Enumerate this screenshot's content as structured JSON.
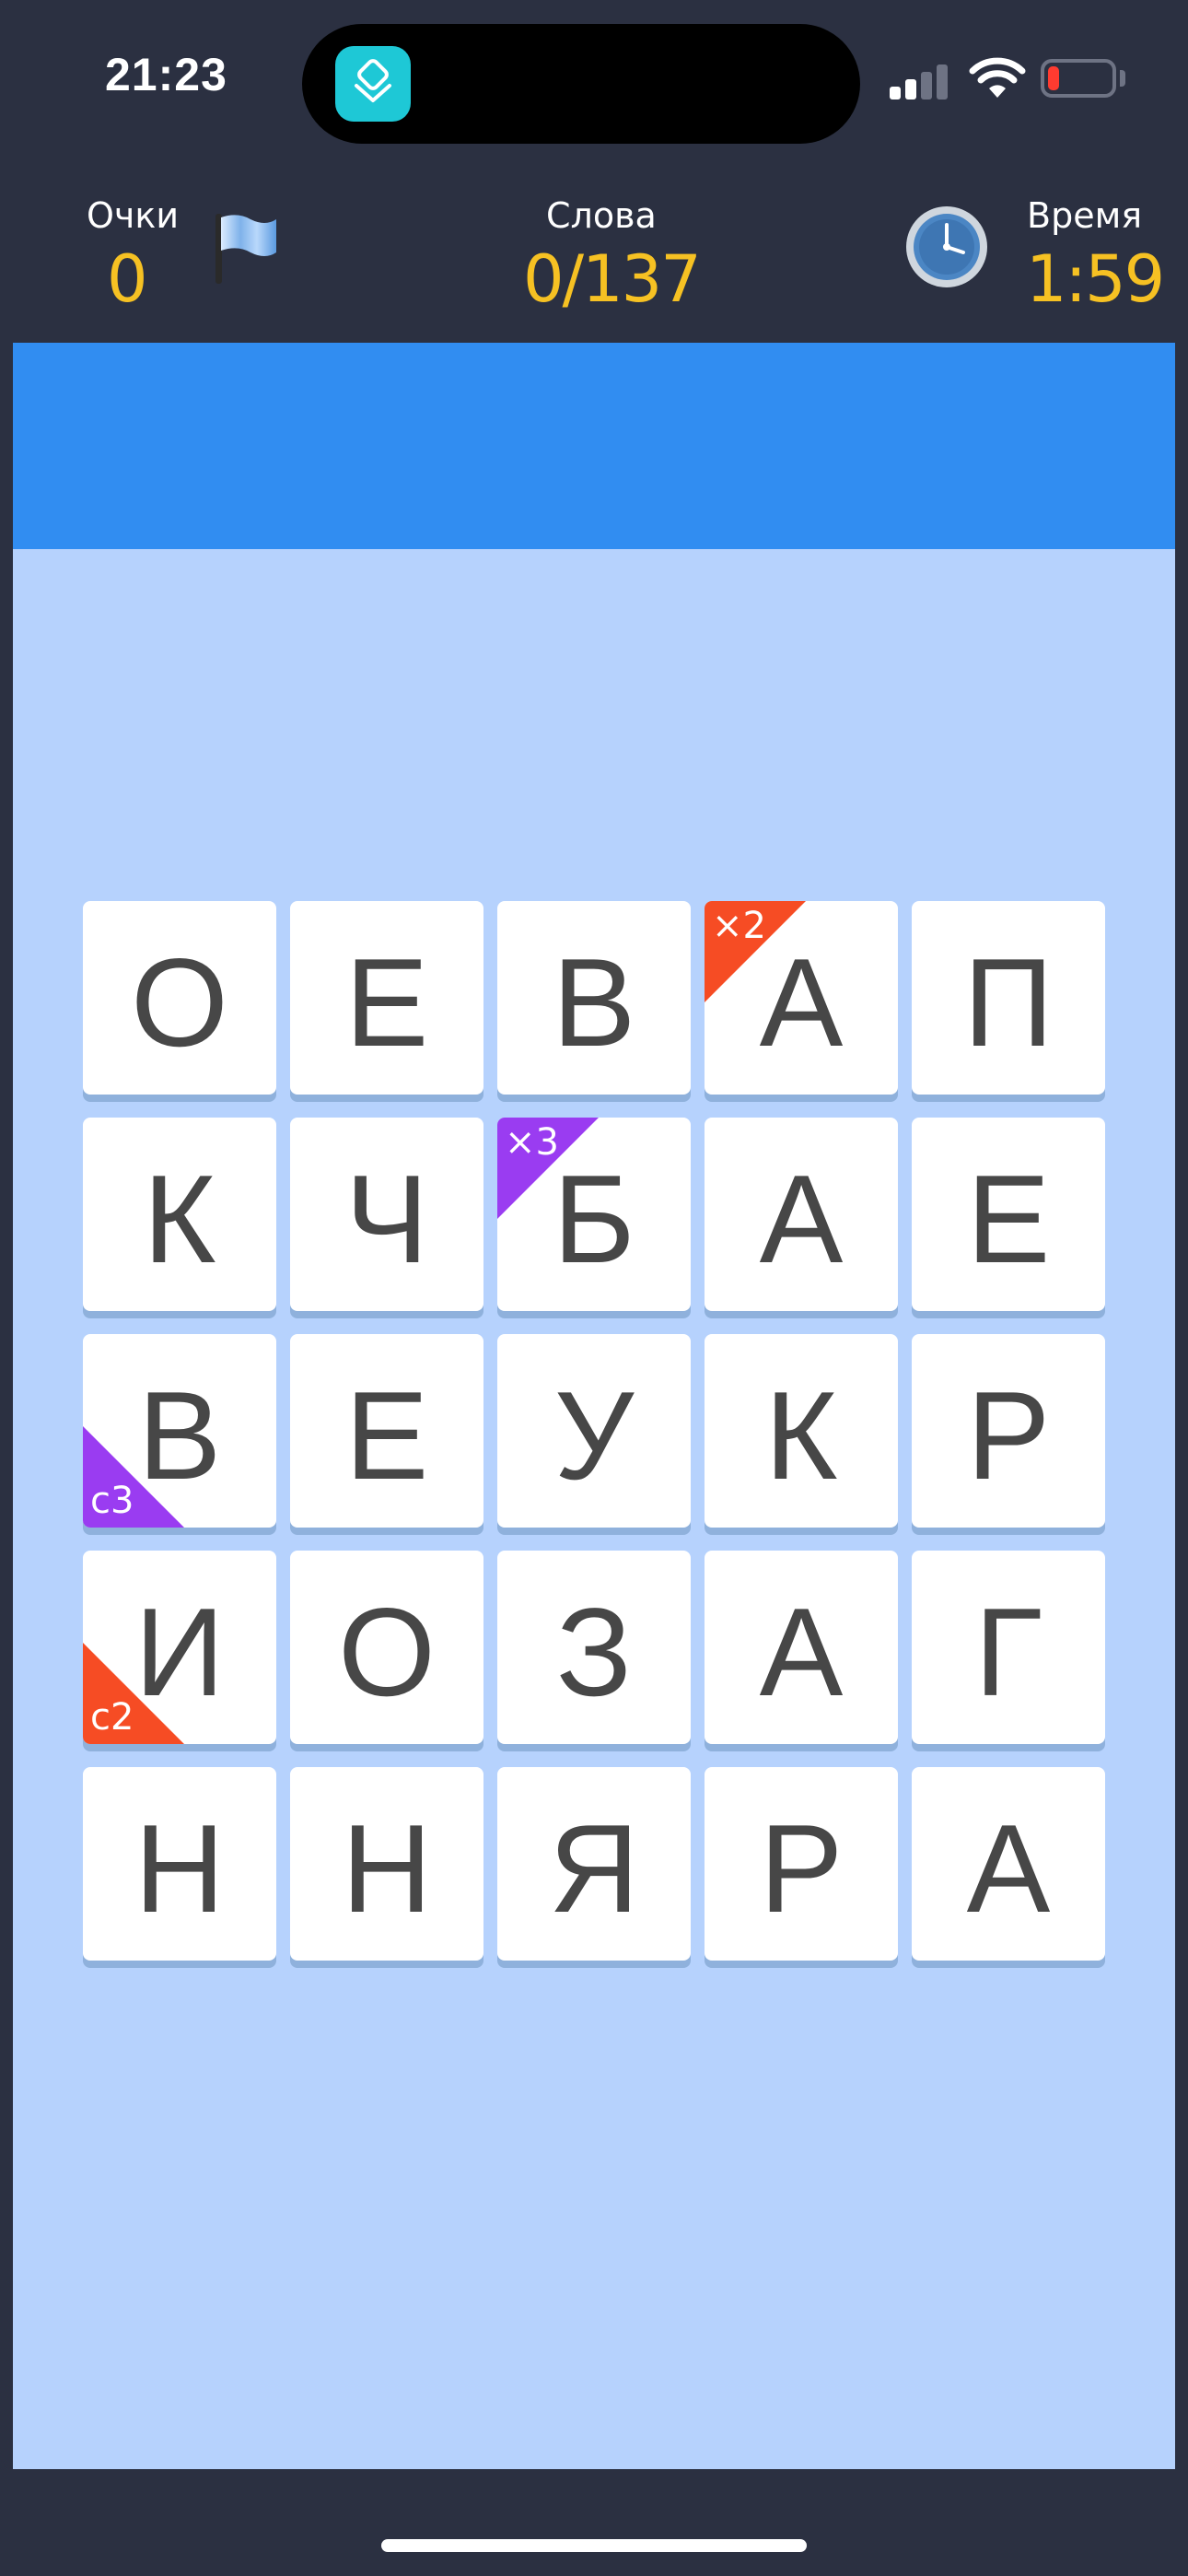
{
  "status_bar": {
    "time": "21:23",
    "app_icon": "layers-icon",
    "battery_color": "#ff3b30"
  },
  "header": {
    "score_label": "Очки",
    "score_value": "0",
    "words_label": "Слова",
    "words_value": "0/137",
    "time_label": "Время",
    "time_value": "1:59",
    "flag_icon": "flag-icon",
    "clock_icon": "clock-icon",
    "value_color": "#f6c123"
  },
  "board": {
    "rows": [
      [
        {
          "letter": "О"
        },
        {
          "letter": "Е"
        },
        {
          "letter": "В"
        },
        {
          "letter": "А",
          "badge": {
            "text": "×2",
            "corner": "top-left",
            "color": "#f64c24"
          }
        },
        {
          "letter": "П"
        }
      ],
      [
        {
          "letter": "К"
        },
        {
          "letter": "Ч"
        },
        {
          "letter": "Б",
          "badge": {
            "text": "×3",
            "corner": "top-left",
            "color": "#9a3cf1"
          }
        },
        {
          "letter": "А"
        },
        {
          "letter": "Е"
        }
      ],
      [
        {
          "letter": "В",
          "badge": {
            "text": "с3",
            "corner": "bottom-left",
            "color": "#9a3cf1"
          }
        },
        {
          "letter": "Е"
        },
        {
          "letter": "У"
        },
        {
          "letter": "К"
        },
        {
          "letter": "Р"
        }
      ],
      [
        {
          "letter": "И",
          "badge": {
            "text": "с2",
            "corner": "bottom-left",
            "color": "#f64c24"
          }
        },
        {
          "letter": "О"
        },
        {
          "letter": "З"
        },
        {
          "letter": "А"
        },
        {
          "letter": "Г"
        }
      ],
      [
        {
          "letter": "Н"
        },
        {
          "letter": "Н"
        },
        {
          "letter": "Я"
        },
        {
          "letter": "Р"
        },
        {
          "letter": "А"
        }
      ]
    ]
  }
}
